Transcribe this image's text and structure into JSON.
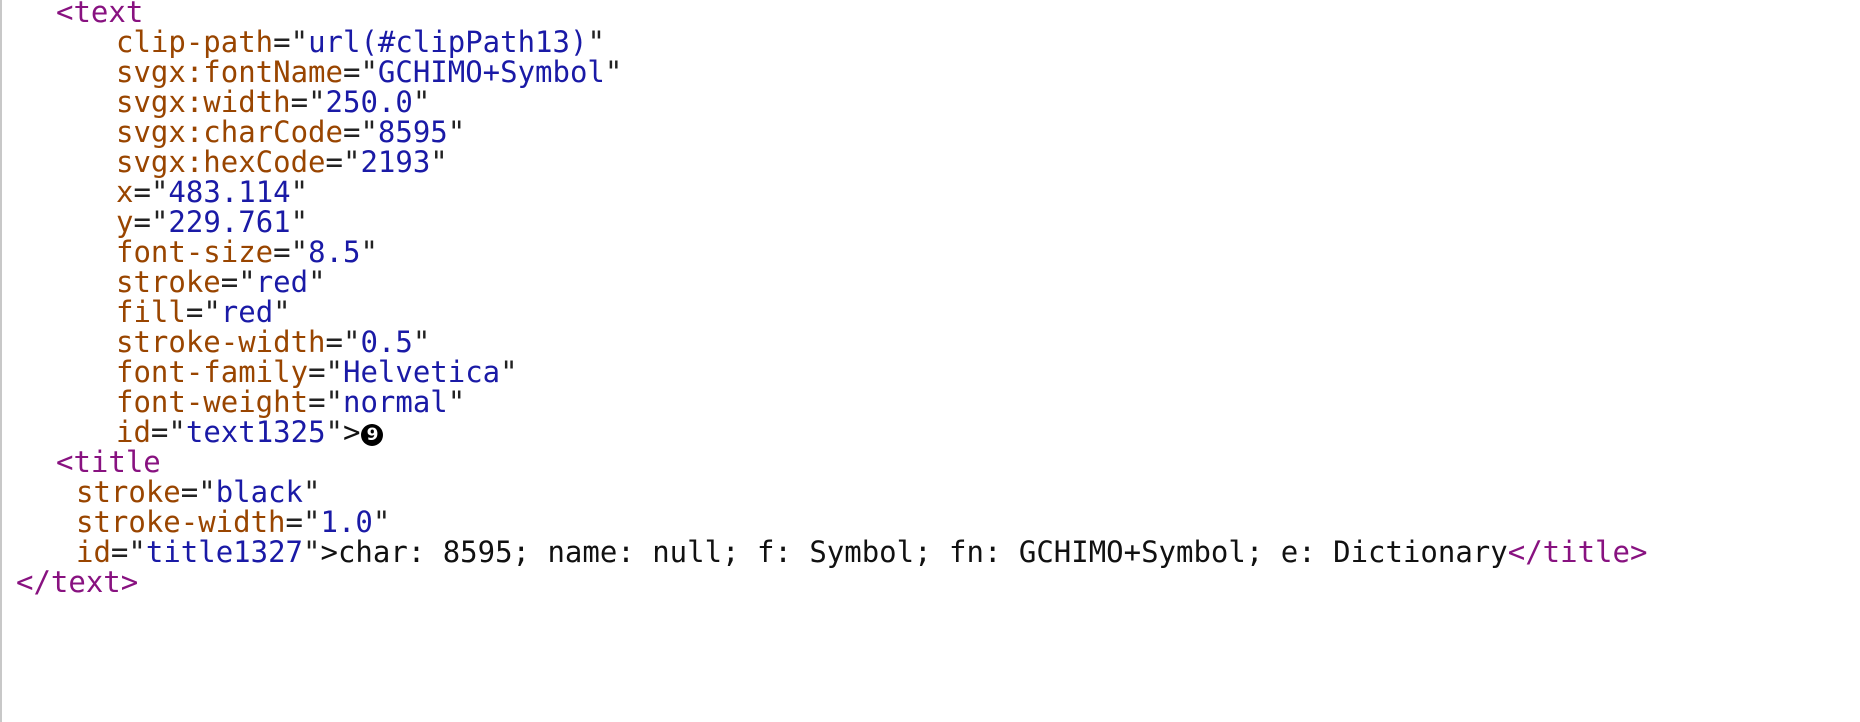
{
  "text_open": "<text",
  "text_attributes": [
    {
      "name": "clip-path",
      "value": "url(#clipPath13)"
    },
    {
      "name": "svgx:fontName",
      "value": "GCHIMO+Symbol"
    },
    {
      "name": "svgx:width",
      "value": "250.0"
    },
    {
      "name": "svgx:charCode",
      "value": "8595"
    },
    {
      "name": "svgx:hexCode",
      "value": "2193"
    },
    {
      "name": "x",
      "value": "483.114"
    },
    {
      "name": "y",
      "value": "229.761"
    },
    {
      "name": "font-size",
      "value": "8.5"
    },
    {
      "name": "stroke",
      "value": "red"
    },
    {
      "name": "fill",
      "value": "red"
    },
    {
      "name": "stroke-width",
      "value": "0.5"
    },
    {
      "name": "font-family",
      "value": "Helvetica"
    },
    {
      "name": "font-weight",
      "value": "normal"
    },
    {
      "name": "id",
      "value": "text1325"
    }
  ],
  "text_content_glyph": "9",
  "title_open": "<title",
  "title_attributes": [
    {
      "name": "stroke",
      "value": "black"
    },
    {
      "name": "stroke-width",
      "value": "1.0"
    },
    {
      "name": "id",
      "value": "title1327"
    }
  ],
  "title_content": "char: 8595; name: null; f: Symbol; fn: GCHIMO+Symbol; e: Dictionary",
  "title_close": "</title>",
  "text_close": "</text>",
  "punct": {
    "eq": "=",
    "quote": "\"",
    "gt": ">"
  },
  "colors": {
    "tag": "#881280",
    "attribute_name": "#994500",
    "attribute_value": "#1a1aa6",
    "text": "#111111"
  }
}
